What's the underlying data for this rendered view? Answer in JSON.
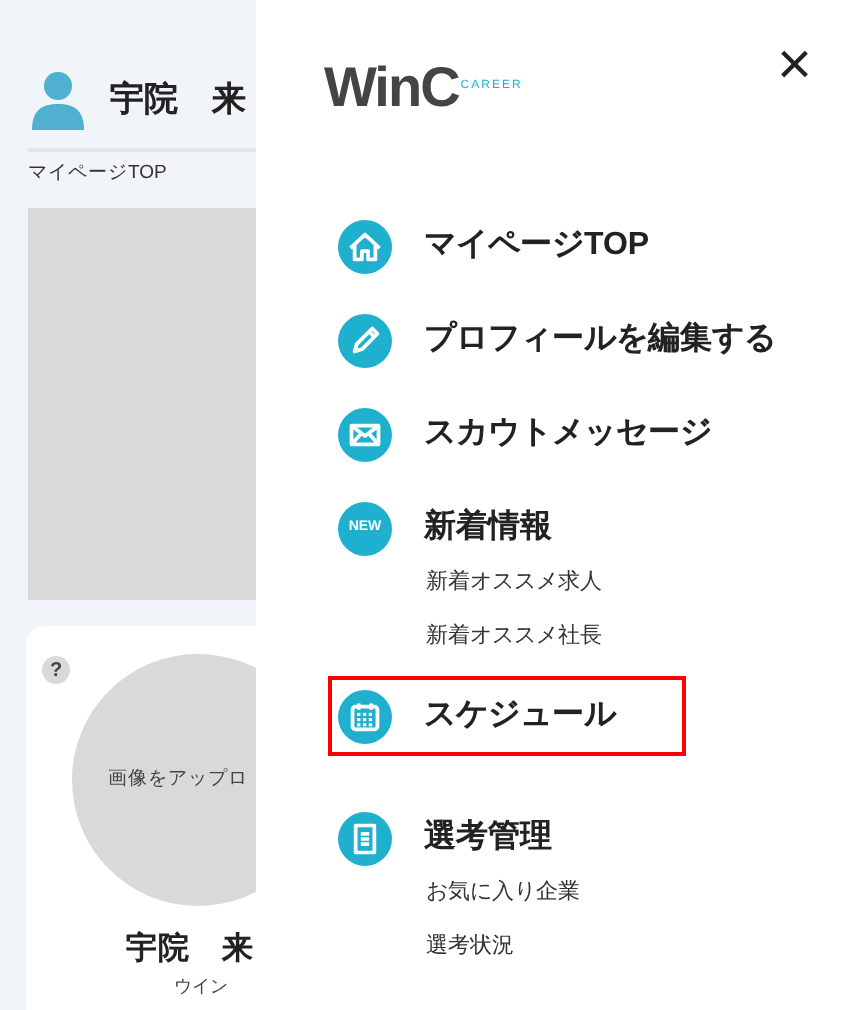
{
  "page": {
    "user_name": "宇院　来",
    "breadcrumb": "マイページTOP",
    "help": "?",
    "upload_text": "画像をアップロ",
    "profile_name": "宇院　来",
    "profile_kana": "ウイン"
  },
  "drawer": {
    "logo": {
      "text": "WinC",
      "sub": "CAREER"
    },
    "close": "×",
    "menu": [
      {
        "label": "マイページTOP",
        "highlighted": false
      },
      {
        "label": "プロフィールを編集する",
        "highlighted": false
      },
      {
        "label": "スカウトメッセージ",
        "highlighted": false
      },
      {
        "label": "新着情報",
        "badge": "NEW",
        "highlighted": false,
        "children": [
          {
            "label": "新着オススメ求人"
          },
          {
            "label": "新着オススメ社長"
          }
        ]
      },
      {
        "label": "スケジュール",
        "highlighted": true
      },
      {
        "label": "選考管理",
        "highlighted": false,
        "children": [
          {
            "label": "お気に入り企業"
          },
          {
            "label": "選考状況"
          }
        ]
      }
    ]
  }
}
